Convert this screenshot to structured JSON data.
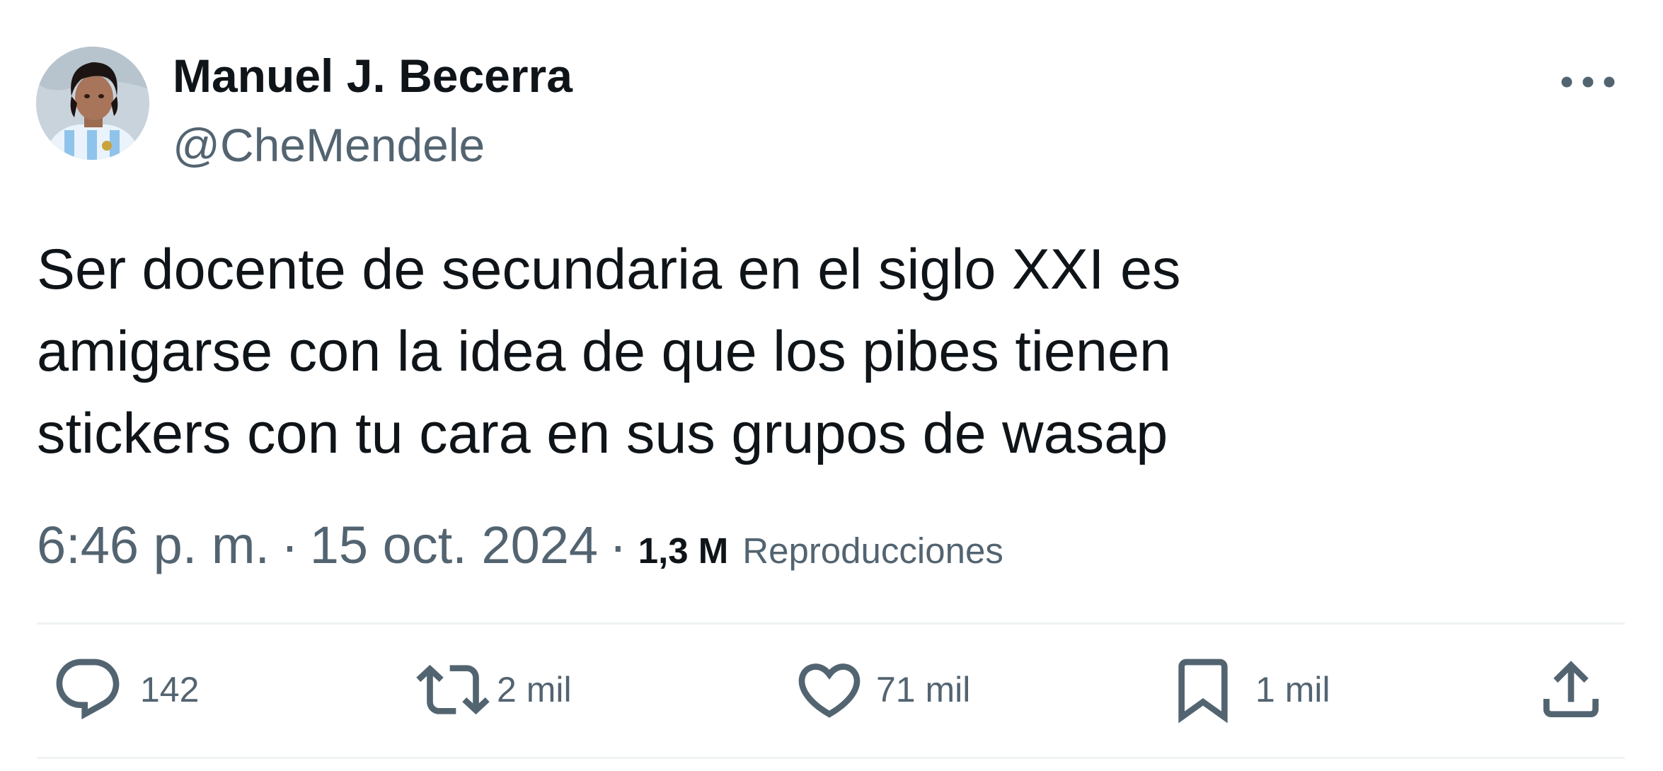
{
  "author": {
    "display_name": "Manuel J. Becerra",
    "handle": "@CheMendele"
  },
  "tweet": {
    "lines": [
      "Ser docente de secundaria en el siglo XXI es",
      "amigarse con la idea de que los pibes tienen",
      "stickers con tu cara en sus grupos de wasap"
    ],
    "time": "6:46 p. m.",
    "separator": "·",
    "date": "15 oct. 2024",
    "views_count": "1,3 M",
    "views_label": "Reproducciones"
  },
  "actions": {
    "replies": "142",
    "reposts": "2 mil",
    "likes": "71 mil",
    "bookmarks": "1 mil"
  },
  "icons": {
    "more": "more-horizontal-icon",
    "reply": "reply-bubble-icon",
    "repost": "repost-arrows-icon",
    "like": "heart-icon",
    "bookmark": "bookmark-icon",
    "share": "share-upload-icon"
  },
  "colors": {
    "text_primary": "#0f1419",
    "text_secondary": "#536471",
    "divider": "#eff3f4",
    "background": "#ffffff"
  }
}
